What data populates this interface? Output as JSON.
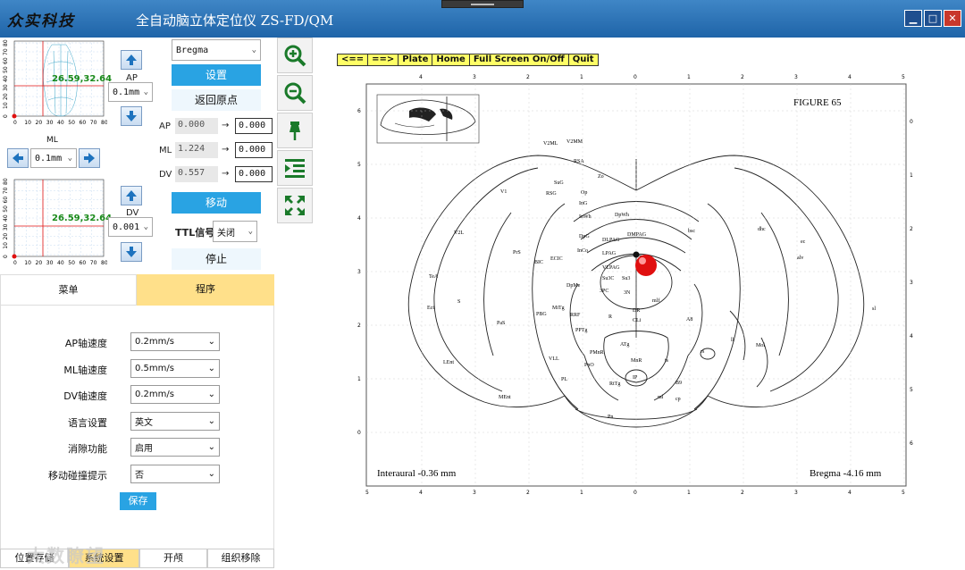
{
  "window": {
    "logo_text": "众实科技",
    "title": "全自动脑立体定位仪 ZS-FD/QM",
    "min_icon": "minimize-icon",
    "max_icon": "maximize-icon",
    "close_icon": "close-icon"
  },
  "plot_top": {
    "xlabel": "ML",
    "coord_label": "26.59,32.64",
    "x_ticks": [
      "0",
      "10",
      "20",
      "30",
      "40",
      "50",
      "60",
      "70",
      "80"
    ],
    "y_ticks": [
      "80",
      "70",
      "60",
      "50",
      "40",
      "30",
      "20",
      "10",
      "0"
    ]
  },
  "plot_bottom": {
    "coord_label": "26.59,32.64",
    "x_ticks": [
      "0",
      "10",
      "20",
      "30",
      "40",
      "50",
      "60",
      "70",
      "80"
    ],
    "y_ticks": [
      "80",
      "70",
      "60",
      "50",
      "40",
      "30",
      "20",
      "10",
      "0"
    ]
  },
  "controls": {
    "ap_label": "AP",
    "ap_step": "0.1mm",
    "ml_step": "0.1mm",
    "dv_label": "DV",
    "dv_step": "0.001",
    "reference_select": "Bregma",
    "set_button": "设置",
    "return_origin": "返回原点",
    "ap_row": {
      "label": "AP",
      "current": "0.000",
      "arrow": "→",
      "target": "0.000"
    },
    "ml_row": {
      "label": "ML",
      "current": "1.224",
      "arrow": "→",
      "target": "0.000"
    },
    "dv_row": {
      "label": "DV",
      "current": "0.557",
      "arrow": "→",
      "target": "0.000"
    },
    "move_button": "移动",
    "ttl_label": "TTL信号",
    "ttl_value": "关闭",
    "stop_button": "停止"
  },
  "tabs": {
    "menu": "菜单",
    "program": "程序"
  },
  "settings": {
    "rows": [
      {
        "label": "AP轴速度",
        "value": "0.2mm/s"
      },
      {
        "label": "ML轴速度",
        "value": "0.5mm/s"
      },
      {
        "label": "DV轴速度",
        "value": "0.2mm/s"
      },
      {
        "label": "语言设置",
        "value": "英文"
      },
      {
        "label": "消隙功能",
        "value": "启用"
      },
      {
        "label": "移动碰撞提示",
        "value": "否"
      }
    ],
    "save_button": "保存"
  },
  "bottom_tabs": [
    "位置存储",
    "系统设置",
    "开颅",
    "组织移除"
  ],
  "watermark": "大数瞭望",
  "toolbar": [
    "zoom-in-icon",
    "zoom-out-icon",
    "pin-icon",
    "indent-list-icon",
    "fullscreen-icon"
  ],
  "atlas_nav": [
    "<==",
    "==>",
    "Plate",
    "Home",
    "Full Screen On/Off",
    "Quit"
  ],
  "atlas": {
    "figure": "FIGURE 65",
    "interaural": "Interaural -0.36 mm",
    "bregma": "Bregma -4.16 mm",
    "top_ticks": [
      "4",
      "3",
      "2",
      "1",
      "0",
      "1",
      "2",
      "3",
      "4",
      "5"
    ],
    "bottom_ticks": [
      "5",
      "4",
      "3",
      "2",
      "1",
      "0",
      "1",
      "2",
      "3",
      "4",
      "5"
    ],
    "left_ticks": [
      "6",
      "5",
      "4",
      "3",
      "2",
      "1",
      "0"
    ],
    "right_ticks": [
      "0",
      "1",
      "2",
      "3",
      "4",
      "5",
      "6"
    ],
    "regions": [
      "V2ML",
      "V2MM",
      "RSA",
      "Zo",
      "SuG",
      "Op",
      "InG",
      "InWh",
      "DpWh",
      "V1",
      "RSG",
      "V2L",
      "DpG",
      "DLPAG",
      "DMPAG",
      "PrS",
      "BIC",
      "ECIC",
      "InCo",
      "LPAG",
      "VLPAG",
      "Su3C",
      "Su3",
      "TeA",
      "S",
      "3PC",
      "DpMe",
      "3N",
      "mlf",
      "Ect",
      "PaS",
      "MiTg",
      "PBG",
      "RRF",
      "R",
      "CLi",
      "A8",
      "PPTg",
      "DR",
      "LEnt",
      "VLL",
      "ATg",
      "PMnR",
      "MnR",
      "ts",
      "PnO",
      "rs",
      "PL",
      "RtTg",
      "IP",
      "MEnt",
      "B9",
      "ml",
      "cp",
      "Pn",
      "Mol",
      "ll",
      "bsc",
      "dhc",
      "ec",
      "alv",
      "sl"
    ]
  },
  "colors": {
    "title_bar": "#2a73b8",
    "accent_blue": "#29a3e3",
    "tab_active": "#ffe08a",
    "marker_red": "#e01010",
    "nav_yellow": "#ffff66"
  }
}
